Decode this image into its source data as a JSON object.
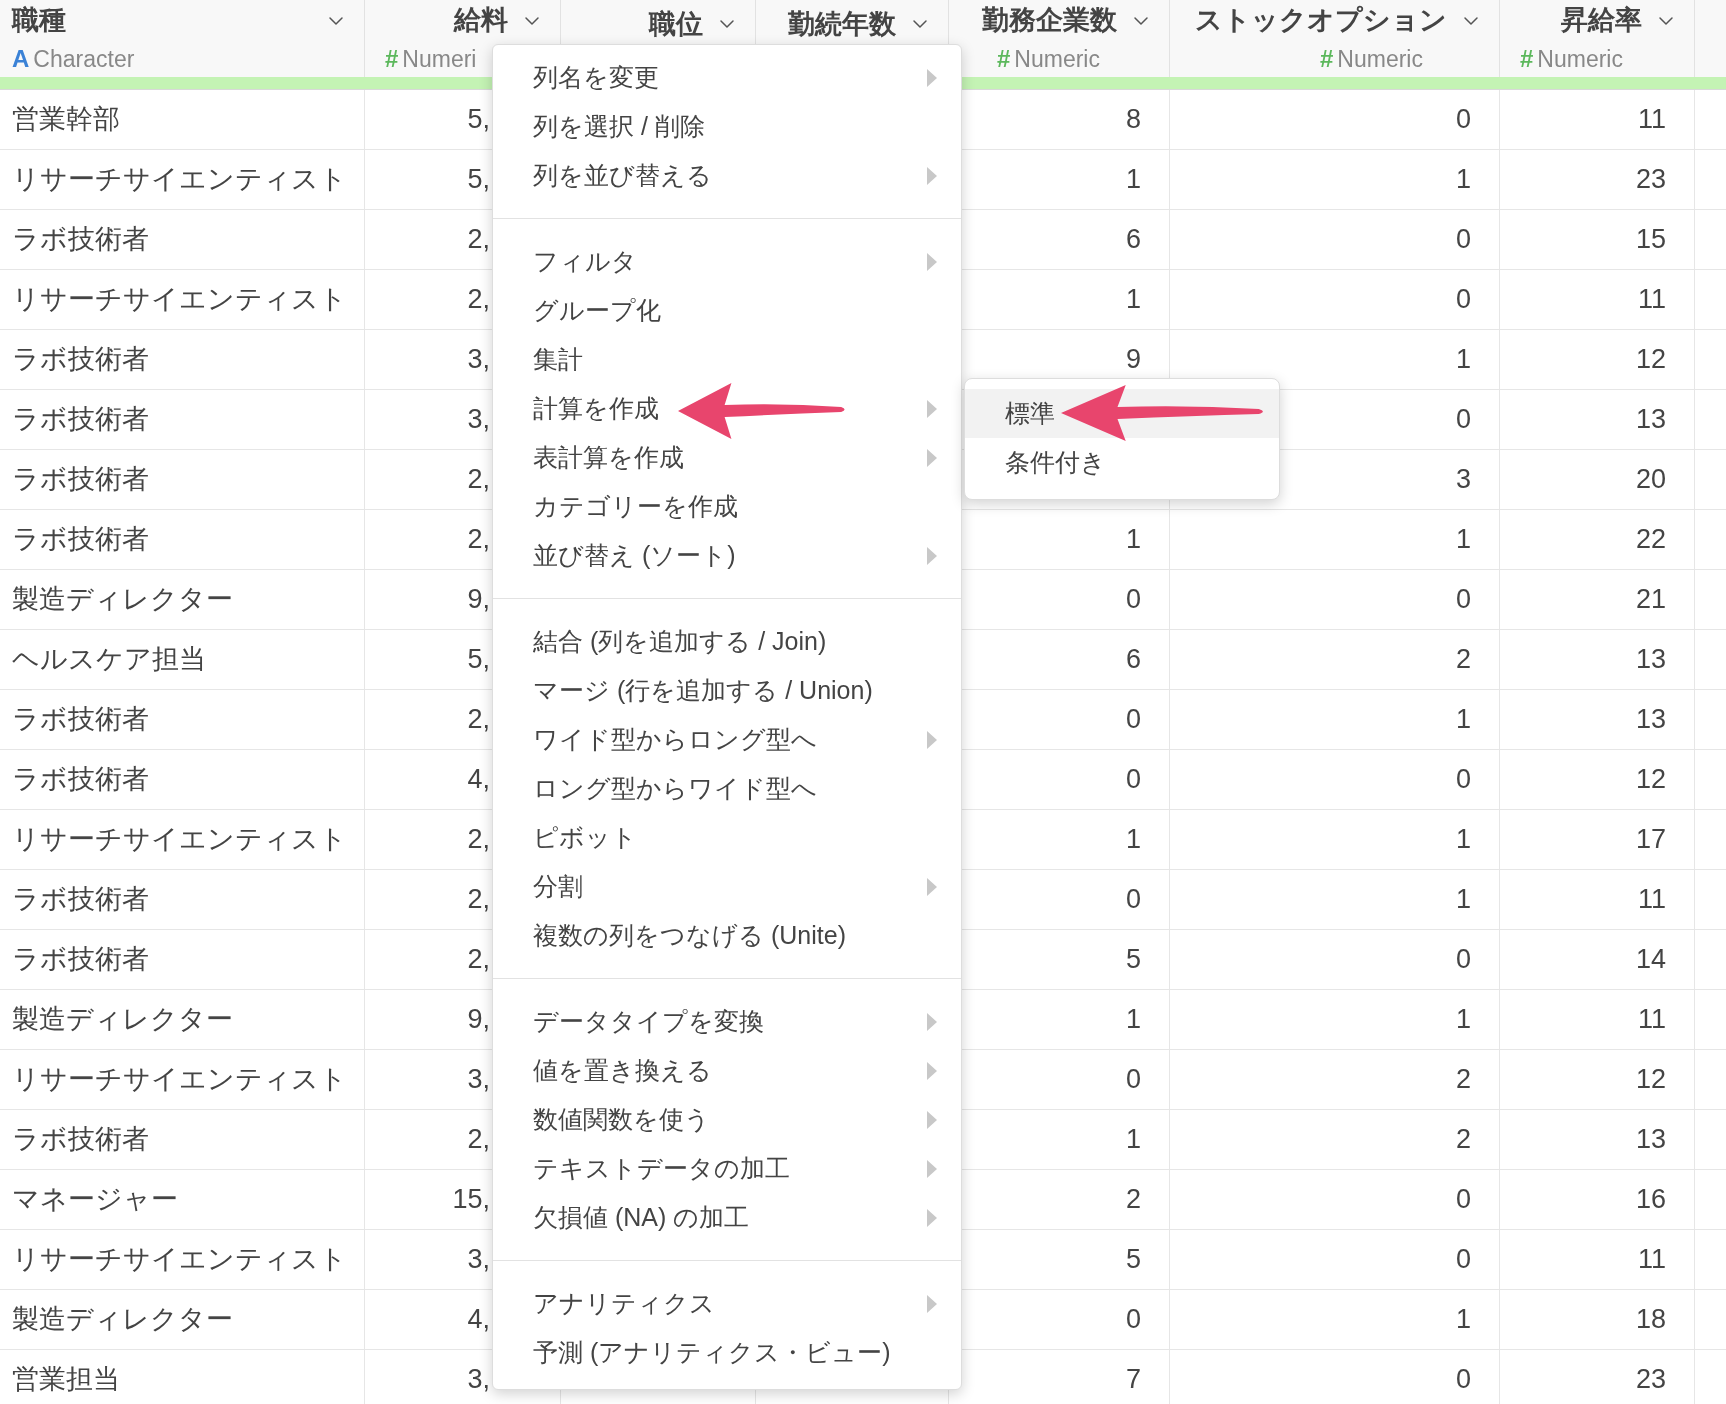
{
  "table": {
    "columns": [
      {
        "name": "職種",
        "kind": "character",
        "type_symbol": "A",
        "type": "Character"
      },
      {
        "name": "給料",
        "kind": "numeric",
        "type_symbol": "#",
        "type": "Numeri"
      },
      {
        "name": "職位"
      },
      {
        "name": "勤続年数"
      },
      {
        "name": "勤務企業数",
        "kind": "numeric",
        "type_symbol": "#",
        "type": "Numeric"
      },
      {
        "name": "ストックオプション",
        "kind": "numeric",
        "type_symbol": "#",
        "type": "Numeric"
      },
      {
        "name": "昇給率",
        "kind": "numeric",
        "type_symbol": "#",
        "type": "Numeric"
      }
    ],
    "rows": [
      [
        "営業幹部",
        "5,",
        null,
        null,
        "8",
        "0",
        "11"
      ],
      [
        "リサーチサイエンティスト",
        "5,",
        null,
        null,
        "1",
        "1",
        "23"
      ],
      [
        "ラボ技術者",
        "2,",
        null,
        null,
        "6",
        "0",
        "15"
      ],
      [
        "リサーチサイエンティスト",
        "2,",
        null,
        null,
        "1",
        "0",
        "11"
      ],
      [
        "ラボ技術者",
        "3,",
        null,
        null,
        "9",
        "1",
        "12"
      ],
      [
        "ラボ技術者",
        "3,",
        null,
        null,
        null,
        "0",
        "13"
      ],
      [
        "ラボ技術者",
        "2,",
        null,
        null,
        null,
        "3",
        "20"
      ],
      [
        "ラボ技術者",
        "2,",
        null,
        null,
        "1",
        "1",
        "22"
      ],
      [
        "製造ディレクター",
        "9,",
        null,
        null,
        "0",
        "0",
        "21"
      ],
      [
        "ヘルスケア担当",
        "5,",
        null,
        null,
        "6",
        "2",
        "13"
      ],
      [
        "ラボ技術者",
        "2,",
        null,
        null,
        "0",
        "1",
        "13"
      ],
      [
        "ラボ技術者",
        "4,",
        null,
        null,
        "0",
        "0",
        "12"
      ],
      [
        "リサーチサイエンティスト",
        "2,",
        null,
        null,
        "1",
        "1",
        "17"
      ],
      [
        "ラボ技術者",
        "2,",
        null,
        null,
        "0",
        "1",
        "11"
      ],
      [
        "ラボ技術者",
        "2,",
        null,
        null,
        "5",
        "0",
        "14"
      ],
      [
        "製造ディレクター",
        "9,",
        null,
        null,
        "1",
        "1",
        "11"
      ],
      [
        "リサーチサイエンティスト",
        "3,",
        null,
        null,
        "0",
        "2",
        "12"
      ],
      [
        "ラボ技術者",
        "2,",
        null,
        null,
        "1",
        "2",
        "13"
      ],
      [
        "マネージャー",
        "15,",
        null,
        null,
        "2",
        "0",
        "16"
      ],
      [
        "リサーチサイエンティスト",
        "3,",
        null,
        null,
        "5",
        "0",
        "11"
      ],
      [
        "製造ディレクター",
        "4,",
        null,
        null,
        "0",
        "1",
        "18"
      ],
      [
        "営業担当",
        "3,",
        null,
        null,
        "7",
        "0",
        "23"
      ]
    ]
  },
  "column_menu": {
    "sections": [
      [
        {
          "label": "列名を変更",
          "has_submenu": true
        },
        {
          "label": "列を選択 / 削除",
          "has_submenu": false
        },
        {
          "label": "列を並び替える",
          "has_submenu": true
        }
      ],
      [
        {
          "label": "フィルタ",
          "has_submenu": true
        },
        {
          "label": "グループ化",
          "has_submenu": false
        },
        {
          "label": "集計",
          "has_submenu": false
        },
        {
          "label": "計算を作成",
          "has_submenu": true
        },
        {
          "label": "表計算を作成",
          "has_submenu": true
        },
        {
          "label": "カテゴリーを作成",
          "has_submenu": false
        },
        {
          "label": "並び替え (ソート)",
          "has_submenu": true
        }
      ],
      [
        {
          "label": "結合 (列を追加する / Join)",
          "has_submenu": false
        },
        {
          "label": "マージ (行を追加する / Union)",
          "has_submenu": false
        },
        {
          "label": "ワイド型からロング型へ",
          "has_submenu": true
        },
        {
          "label": "ロング型からワイド型へ",
          "has_submenu": false
        },
        {
          "label": "ピボット",
          "has_submenu": false
        },
        {
          "label": "分割",
          "has_submenu": true
        },
        {
          "label": "複数の列をつなげる (Unite)",
          "has_submenu": false
        }
      ],
      [
        {
          "label": "データタイプを変換",
          "has_submenu": true
        },
        {
          "label": "値を置き換える",
          "has_submenu": true
        },
        {
          "label": "数値関数を使う",
          "has_submenu": true
        },
        {
          "label": "テキストデータの加工",
          "has_submenu": true
        },
        {
          "label": "欠損値 (NA) の加工",
          "has_submenu": true
        }
      ],
      [
        {
          "label": "アナリティクス",
          "has_submenu": true
        },
        {
          "label": "予測 (アナリティクス・ビュー)",
          "has_submenu": false
        }
      ]
    ]
  },
  "submenu": {
    "items": [
      {
        "label": "標準",
        "selected": true
      },
      {
        "label": "条件付き",
        "selected": false
      }
    ]
  }
}
